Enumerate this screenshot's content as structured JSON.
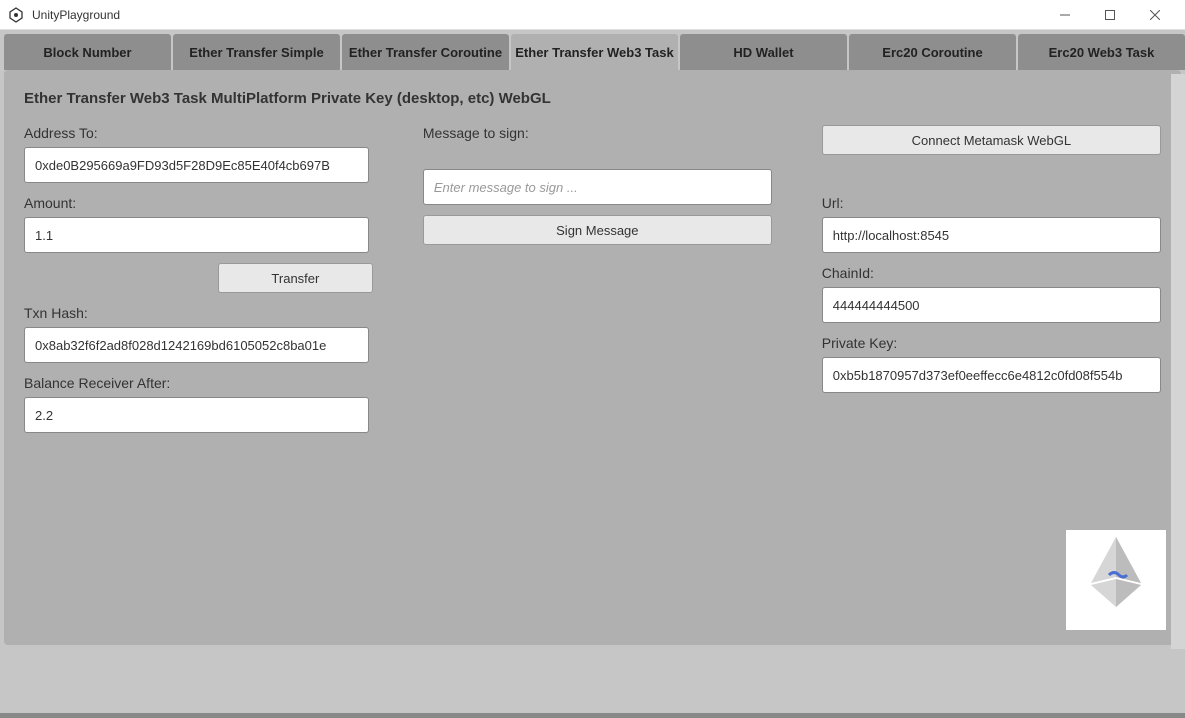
{
  "window": {
    "title": "UnityPlayground"
  },
  "tabs": [
    {
      "label": "Block Number"
    },
    {
      "label": "Ether Transfer Simple"
    },
    {
      "label": "Ether Transfer Coroutine"
    },
    {
      "label": "Ether Transfer Web3 Task"
    },
    {
      "label": "HD Wallet"
    },
    {
      "label": "Erc20 Coroutine"
    },
    {
      "label": "Erc20 Web3 Task"
    }
  ],
  "panel": {
    "title": "Ether Transfer Web3 Task MultiPlatform Private Key (desktop, etc) WebGL"
  },
  "col1": {
    "address_to_label": "Address To:",
    "address_to_value": "0xde0B295669a9FD93d5F28D9Ec85E40f4cb697B",
    "amount_label": "Amount:",
    "amount_value": "1.1",
    "transfer_label": "Transfer",
    "txn_hash_label": "Txn Hash:",
    "txn_hash_value": "0x8ab32f6f2ad8f028d1242169bd6105052c8ba01e",
    "balance_after_label": "Balance Receiver After:",
    "balance_after_value": "2.2"
  },
  "col2": {
    "message_label": "Message to sign:",
    "message_placeholder": "Enter message to sign ...",
    "sign_button_label": "Sign Message"
  },
  "col3": {
    "connect_label": "Connect Metamask WebGL",
    "url_label": "Url:",
    "url_value": "http://localhost:8545",
    "chainid_label": "ChainId:",
    "chainid_value": "444444444500",
    "private_key_label": "Private Key:",
    "private_key_value": "0xb5b1870957d373ef0eeffecc6e4812c0fd08f554b"
  }
}
